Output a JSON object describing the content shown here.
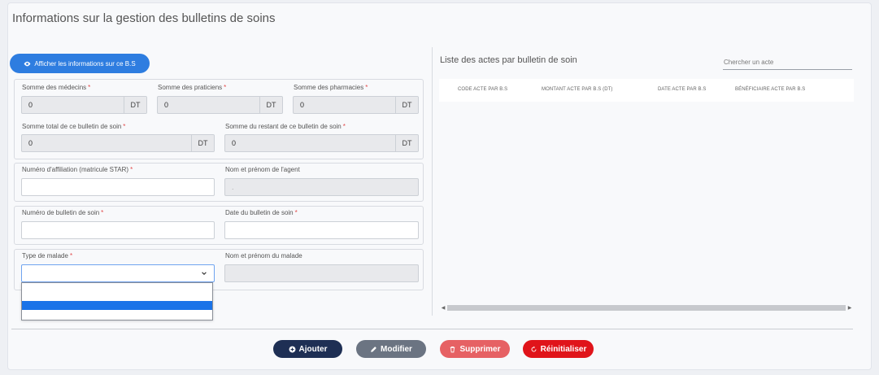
{
  "page": {
    "title": "Informations sur la gestion des bulletins de soins"
  },
  "info_button": {
    "label": "Afficher les informations sur ce B.S"
  },
  "required_mark": "*",
  "currency": "DT",
  "totals": {
    "medecins": {
      "label": "Somme des médecins",
      "value": "0"
    },
    "praticiens": {
      "label": "Somme des praticiens",
      "value": "0"
    },
    "pharmacies": {
      "label": "Somme des pharmacies",
      "value": "0"
    },
    "total": {
      "label": "Somme total de ce bulletin de soin",
      "value": "0"
    },
    "restant": {
      "label": "Somme du restant de ce bulletin de soin",
      "value": "0"
    }
  },
  "agent": {
    "affiliation_label": "Numéro d'affiliation (matricule STAR)",
    "affiliation_value": "",
    "name_label": "Nom et prénom de l'agent",
    "name_value": "."
  },
  "bulletin": {
    "number_label": "Numéro de bulletin de soin",
    "number_value": "",
    "date_label": "Date du bulletin de soin",
    "date_value": ""
  },
  "patient": {
    "type_label": "Type de malade",
    "type_value": "",
    "name_label": "Nom et prénom du malade",
    "name_value": ""
  },
  "acts": {
    "title": "Liste des actes par bulletin de soin",
    "search_placeholder": "Chercher un acte",
    "columns": [
      "CODE ACTE PAR B.S",
      "MONTANT ACTE PAR B.S (DT)",
      "DATE ACTE PAR B.S",
      "BÉNÉFICIAIRE ACTE PAR B.S"
    ]
  },
  "actions": {
    "add": "Ajouter",
    "edit": "Modifier",
    "delete": "Supprimer",
    "reset": "Réinitialiser"
  },
  "colors": {
    "primary": "#2e7de0",
    "add": "#1e2f54",
    "edit": "#6b7482",
    "delete": "#e66164",
    "reset": "#e0141a"
  }
}
